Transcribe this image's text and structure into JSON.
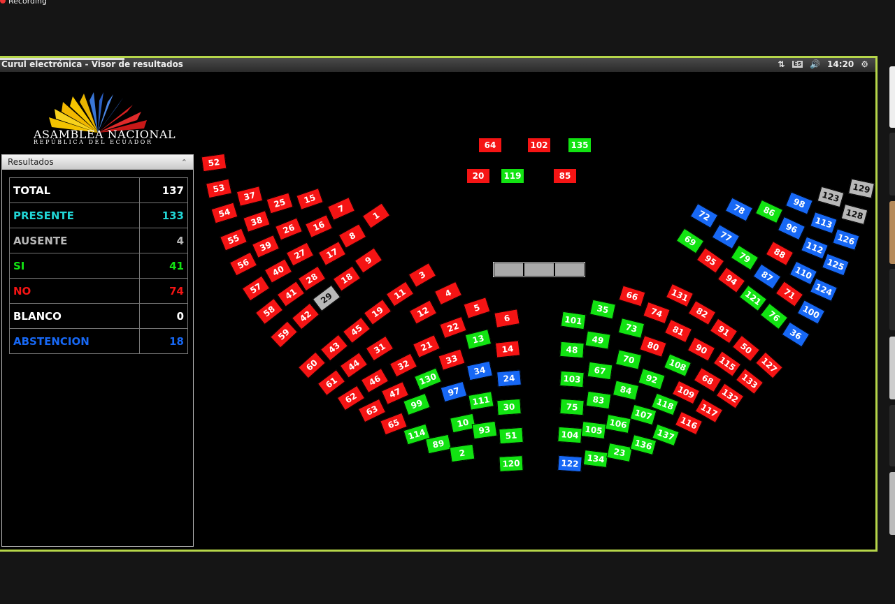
{
  "recording_label": "Recording",
  "window_title": "Curul electrónica - Visor de resultados",
  "tray": {
    "lang": "Es",
    "time": "14:20"
  },
  "logo": {
    "name": "ASAMBLEA NACIONAL",
    "subtitle": "REPÚBLICA DEL ECUADOR"
  },
  "panel": {
    "title": "Resultados",
    "rows": [
      {
        "label": "TOTAL",
        "value": "137",
        "color": "#ffffff"
      },
      {
        "label": "PRESENTE",
        "value": "133",
        "color": "#21d6d6"
      },
      {
        "label": "AUSENTE",
        "value": "4",
        "color": "#b8b8b8"
      },
      {
        "label": "SI",
        "value": "41",
        "color": "#12e312"
      },
      {
        "label": "NO",
        "value": "74",
        "color": "#f51414"
      },
      {
        "label": "BLANCO",
        "value": "0",
        "color": "#ffffff"
      },
      {
        "label": "ABSTENCION",
        "value": "18",
        "color": "#1768f5"
      }
    ]
  },
  "colors": {
    "no": "#f51414",
    "si": "#12e312",
    "abstencion": "#1768f5",
    "ausente": "#b8b8b8"
  },
  "seats": [
    {
      "n": "64",
      "s": "r"
    },
    {
      "n": "102",
      "s": "r"
    },
    {
      "n": "135",
      "s": "g"
    },
    {
      "n": "20",
      "s": "r"
    },
    {
      "n": "119",
      "s": "g"
    },
    {
      "n": "85",
      "s": "r"
    },
    {
      "n": "52",
      "s": "r"
    },
    {
      "n": "53",
      "s": "r"
    },
    {
      "n": "54",
      "s": "r"
    },
    {
      "n": "55",
      "s": "r"
    },
    {
      "n": "56",
      "s": "r"
    },
    {
      "n": "57",
      "s": "r"
    },
    {
      "n": "58",
      "s": "r"
    },
    {
      "n": "59",
      "s": "r"
    },
    {
      "n": "37",
      "s": "r"
    },
    {
      "n": "38",
      "s": "r"
    },
    {
      "n": "39",
      "s": "r"
    },
    {
      "n": "40",
      "s": "r"
    },
    {
      "n": "41",
      "s": "r"
    },
    {
      "n": "42",
      "s": "r"
    },
    {
      "n": "25",
      "s": "r"
    },
    {
      "n": "26",
      "s": "r"
    },
    {
      "n": "27",
      "s": "r"
    },
    {
      "n": "28",
      "s": "r"
    },
    {
      "n": "29",
      "s": "w"
    },
    {
      "n": "15",
      "s": "r"
    },
    {
      "n": "16",
      "s": "r"
    },
    {
      "n": "17",
      "s": "r"
    },
    {
      "n": "18",
      "s": "r"
    },
    {
      "n": "7",
      "s": "r"
    },
    {
      "n": "8",
      "s": "r"
    },
    {
      "n": "9",
      "s": "r"
    },
    {
      "n": "1",
      "s": "r"
    },
    {
      "n": "3",
      "s": "r"
    },
    {
      "n": "4",
      "s": "r"
    },
    {
      "n": "5",
      "s": "r"
    },
    {
      "n": "6",
      "s": "r"
    },
    {
      "n": "11",
      "s": "r"
    },
    {
      "n": "12",
      "s": "r"
    },
    {
      "n": "22",
      "s": "r"
    },
    {
      "n": "13",
      "s": "g"
    },
    {
      "n": "14",
      "s": "r"
    },
    {
      "n": "19",
      "s": "r"
    },
    {
      "n": "21",
      "s": "r"
    },
    {
      "n": "33",
      "s": "r"
    },
    {
      "n": "34",
      "s": "b"
    },
    {
      "n": "24",
      "s": "b"
    },
    {
      "n": "45",
      "s": "r"
    },
    {
      "n": "31",
      "s": "r"
    },
    {
      "n": "32",
      "s": "r"
    },
    {
      "n": "130",
      "s": "g"
    },
    {
      "n": "97",
      "s": "b"
    },
    {
      "n": "111",
      "s": "g"
    },
    {
      "n": "30",
      "s": "g"
    },
    {
      "n": "43",
      "s": "r"
    },
    {
      "n": "44",
      "s": "r"
    },
    {
      "n": "46",
      "s": "r"
    },
    {
      "n": "47",
      "s": "r"
    },
    {
      "n": "99",
      "s": "g"
    },
    {
      "n": "10",
      "s": "g"
    },
    {
      "n": "93",
      "s": "g"
    },
    {
      "n": "51",
      "s": "g"
    },
    {
      "n": "60",
      "s": "r"
    },
    {
      "n": "61",
      "s": "r"
    },
    {
      "n": "62",
      "s": "r"
    },
    {
      "n": "63",
      "s": "r"
    },
    {
      "n": "65",
      "s": "r"
    },
    {
      "n": "114",
      "s": "g"
    },
    {
      "n": "89",
      "s": "g"
    },
    {
      "n": "2",
      "s": "g"
    },
    {
      "n": "120",
      "s": "g"
    },
    {
      "n": "101",
      "s": "g"
    },
    {
      "n": "35",
      "s": "g"
    },
    {
      "n": "66",
      "s": "r"
    },
    {
      "n": "48",
      "s": "g"
    },
    {
      "n": "49",
      "s": "g"
    },
    {
      "n": "73",
      "s": "g"
    },
    {
      "n": "74",
      "s": "r"
    },
    {
      "n": "131",
      "s": "r"
    },
    {
      "n": "103",
      "s": "g"
    },
    {
      "n": "67",
      "s": "g"
    },
    {
      "n": "70",
      "s": "g"
    },
    {
      "n": "80",
      "s": "r"
    },
    {
      "n": "81",
      "s": "r"
    },
    {
      "n": "82",
      "s": "r"
    },
    {
      "n": "75",
      "s": "g"
    },
    {
      "n": "83",
      "s": "g"
    },
    {
      "n": "84",
      "s": "g"
    },
    {
      "n": "92",
      "s": "g"
    },
    {
      "n": "108",
      "s": "g"
    },
    {
      "n": "90",
      "s": "r"
    },
    {
      "n": "91",
      "s": "r"
    },
    {
      "n": "104",
      "s": "g"
    },
    {
      "n": "105",
      "s": "g"
    },
    {
      "n": "106",
      "s": "g"
    },
    {
      "n": "107",
      "s": "g"
    },
    {
      "n": "118",
      "s": "g"
    },
    {
      "n": "109",
      "s": "r"
    },
    {
      "n": "68",
      "s": "r"
    },
    {
      "n": "115",
      "s": "r"
    },
    {
      "n": "50",
      "s": "r"
    },
    {
      "n": "122",
      "s": "b"
    },
    {
      "n": "134",
      "s": "g"
    },
    {
      "n": "23",
      "s": "g"
    },
    {
      "n": "136",
      "s": "g"
    },
    {
      "n": "137",
      "s": "g"
    },
    {
      "n": "116",
      "s": "r"
    },
    {
      "n": "117",
      "s": "r"
    },
    {
      "n": "132",
      "s": "r"
    },
    {
      "n": "133",
      "s": "r"
    },
    {
      "n": "127",
      "s": "r"
    },
    {
      "n": "72",
      "s": "b"
    },
    {
      "n": "69",
      "s": "g"
    },
    {
      "n": "78",
      "s": "b"
    },
    {
      "n": "77",
      "s": "b"
    },
    {
      "n": "95",
      "s": "r"
    },
    {
      "n": "86",
      "s": "g"
    },
    {
      "n": "79",
      "s": "g"
    },
    {
      "n": "94",
      "s": "r"
    },
    {
      "n": "98",
      "s": "b"
    },
    {
      "n": "96",
      "s": "b"
    },
    {
      "n": "88",
      "s": "r"
    },
    {
      "n": "87",
      "s": "b"
    },
    {
      "n": "121",
      "s": "g"
    },
    {
      "n": "71",
      "s": "r"
    },
    {
      "n": "76",
      "s": "g"
    },
    {
      "n": "123",
      "s": "w"
    },
    {
      "n": "113",
      "s": "b"
    },
    {
      "n": "112",
      "s": "b"
    },
    {
      "n": "110",
      "s": "b"
    },
    {
      "n": "124",
      "s": "b"
    },
    {
      "n": "100",
      "s": "b"
    },
    {
      "n": "36",
      "s": "b"
    },
    {
      "n": "129",
      "s": "w"
    },
    {
      "n": "128",
      "s": "w"
    },
    {
      "n": "126",
      "s": "b"
    },
    {
      "n": "125",
      "s": "b"
    }
  ]
}
